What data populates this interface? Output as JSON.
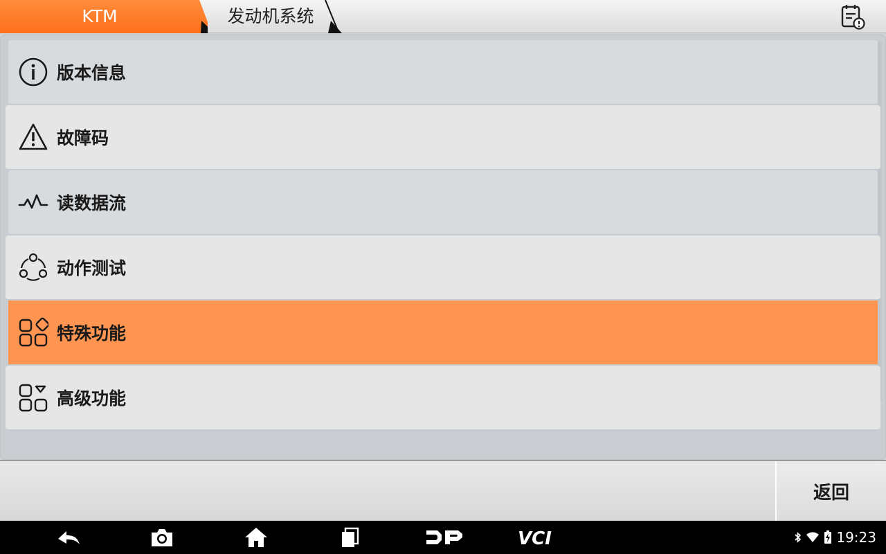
{
  "breadcrumb": {
    "brand": "KTM",
    "system": "发动机系统"
  },
  "colors": {
    "accent": "#ff7a2a",
    "active_row": "#ff9550",
    "text": "#1a1a1a"
  },
  "toolbar": {
    "report_icon": "report-icon"
  },
  "menu": {
    "items": [
      {
        "label": "版本信息",
        "icon": "info-icon"
      },
      {
        "label": "故障码",
        "icon": "warning-icon"
      },
      {
        "label": "读数据流",
        "icon": "waveform-icon"
      },
      {
        "label": "动作测试",
        "icon": "cycle-icon"
      },
      {
        "label": "特殊功能",
        "icon": "special-function-icon",
        "selected": true
      },
      {
        "label": "高级功能",
        "icon": "advanced-function-icon"
      }
    ]
  },
  "footer": {
    "back_label": "返回"
  },
  "navbar": {
    "icons": [
      "back-icon",
      "screenshot-icon",
      "home-icon",
      "recents-icon",
      "dp-icon",
      "vci-icon"
    ],
    "dp_label": "DP",
    "vci_label": "VCI"
  },
  "status": {
    "time": "19:23",
    "icons": [
      "bluetooth-icon",
      "wifi-icon",
      "battery-icon"
    ]
  }
}
